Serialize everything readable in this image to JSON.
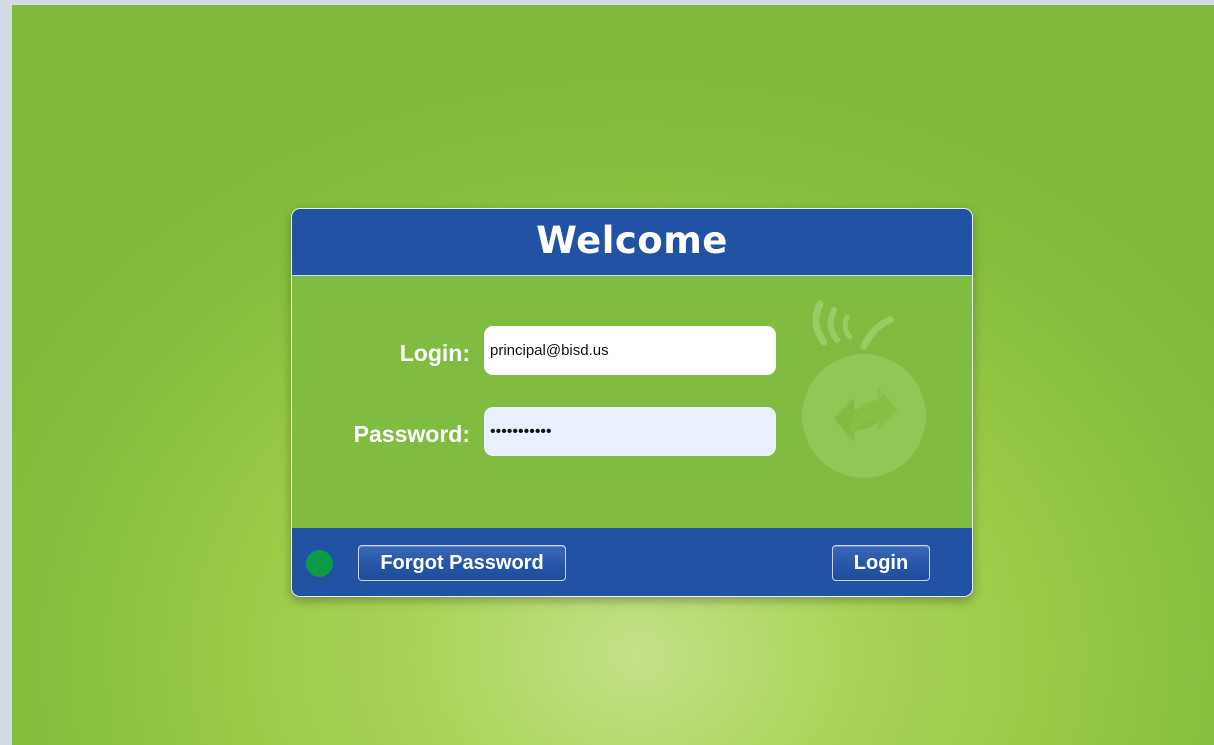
{
  "dialog": {
    "title": "Welcome"
  },
  "form": {
    "login_label": "Login:",
    "login_value": "principal@bisd.us",
    "password_label": "Password:",
    "password_value": "•••••••••••"
  },
  "footer": {
    "forgot_password_label": "Forgot Password",
    "login_button_label": "Login",
    "status_indicator_color": "#0a9a48"
  },
  "icons": {
    "watermark": "apple-signal-refresh-icon",
    "status": "status-dot-icon"
  },
  "colors": {
    "header_blue": "#2152a4",
    "body_green": "#80bc42",
    "page_green": "#9bc944"
  }
}
